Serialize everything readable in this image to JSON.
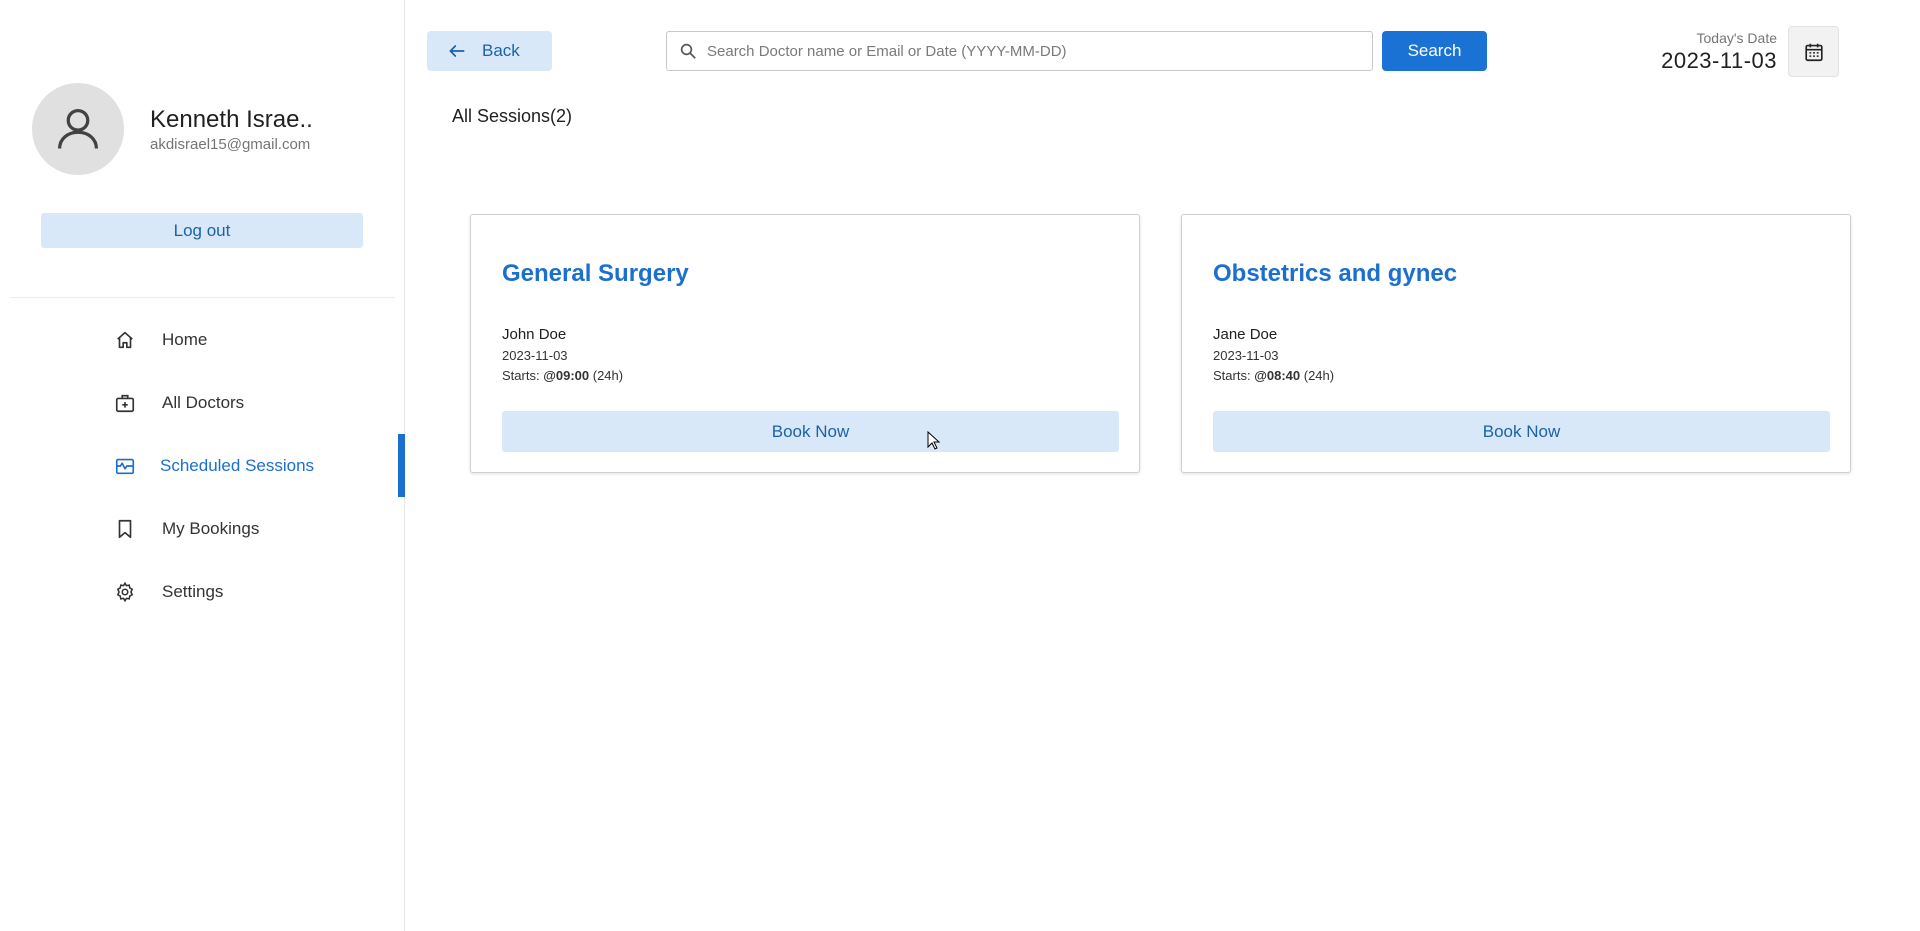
{
  "profile": {
    "name": "Kenneth Israe..",
    "email": "akdisrael15@gmail.com",
    "logout_label": "Log out"
  },
  "sidebar": {
    "items": [
      {
        "label": "Home",
        "icon": "home-icon",
        "active": false
      },
      {
        "label": "All Doctors",
        "icon": "medical-bag-icon",
        "active": false
      },
      {
        "label": "Scheduled Sessions",
        "icon": "schedule-icon",
        "active": true
      },
      {
        "label": "My Bookings",
        "icon": "bookmark-icon",
        "active": false
      },
      {
        "label": "Settings",
        "icon": "gear-icon",
        "active": false
      }
    ],
    "accent_color": "#1a6fd1"
  },
  "header": {
    "back_label": "Back",
    "search_placeholder": "Search Doctor name or Email or Date (YYYY-MM-DD)",
    "search_value": "",
    "search_button_label": "Search",
    "date_label": "Today's Date",
    "date_value": "2023-11-03"
  },
  "main": {
    "sessions_title": "All Sessions(2)",
    "sessions": [
      {
        "title": "General Surgery",
        "doctor": "John Doe",
        "date": "2023-11-03",
        "starts_prefix": "Starts: ",
        "starts_time": "@09:00",
        "starts_suffix": " (24h)",
        "button_label": "Book Now"
      },
      {
        "title": "Obstetrics and gynec",
        "doctor": "Jane Doe",
        "date": "2023-11-03",
        "starts_prefix": "Starts: ",
        "starts_time": "@08:40",
        "starts_suffix": " (24h)",
        "button_label": "Book Now"
      }
    ]
  },
  "colors": {
    "primary": "#1a73d4",
    "button_light": "#d8e8f8",
    "button_light_text": "#1b62a8"
  }
}
